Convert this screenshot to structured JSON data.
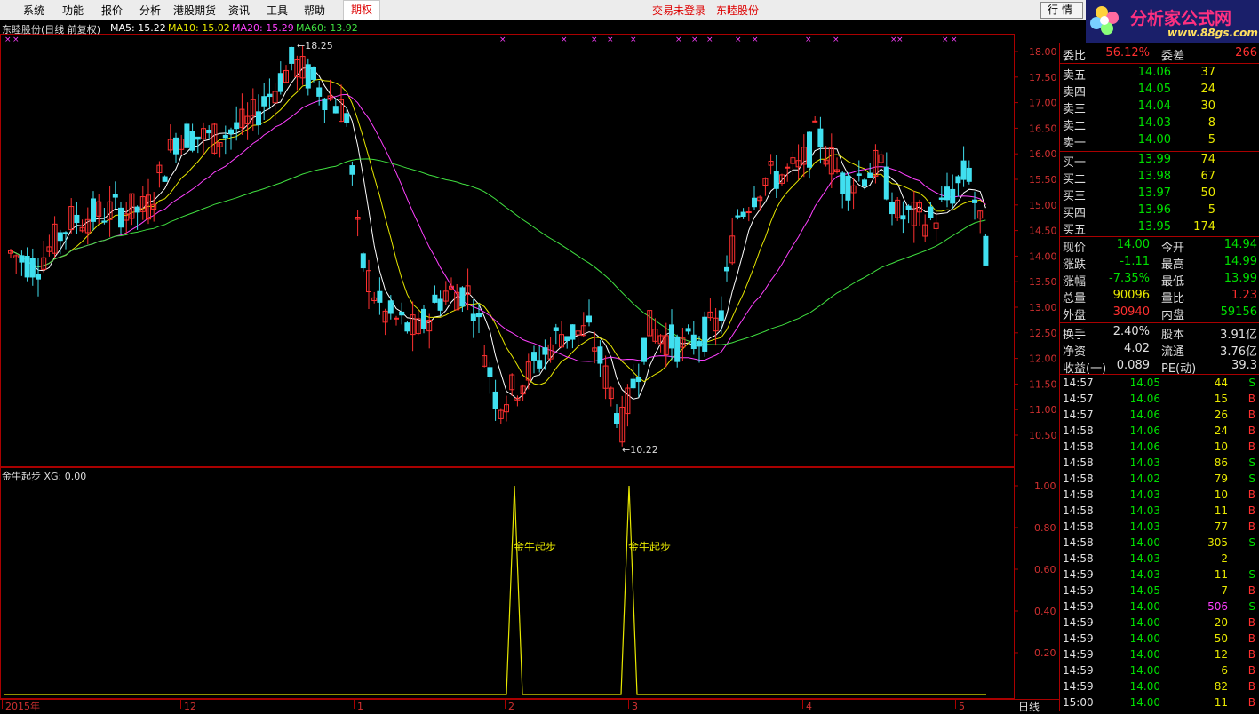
{
  "menu": {
    "items": [
      "系统",
      "功能",
      "报价",
      "分析",
      "港股期货",
      "资讯",
      "工具",
      "帮助"
    ],
    "option_tab": "期权",
    "status_login": "交易未登录",
    "status_stock": "东睦股份",
    "market_button": "行情"
  },
  "logo": {
    "brand": "分析家公式网",
    "url_text": "www.88gs.com"
  },
  "kline": {
    "title": "东睦股份(日线 前复权)",
    "ma5_label": "MA5: 15.22",
    "ma10_label": "MA10: 15.02",
    "ma20_label": "MA20: 15.29",
    "ma60_label": "MA60: 13.92",
    "high_mark": "18.25",
    "low_mark": "10.22",
    "y_ticks": [
      "18.00",
      "17.50",
      "17.00",
      "16.50",
      "16.00",
      "15.50",
      "15.00",
      "14.50",
      "14.00",
      "13.50",
      "13.00",
      "12.50",
      "12.00",
      "11.50",
      "11.00",
      "10.50"
    ],
    "x_ticks": [
      "2015年",
      "12",
      "1",
      "2",
      "3",
      "4",
      "5"
    ],
    "period_tab": "日线",
    "colors": {
      "up": "#ff3030",
      "down": "#40e0f0",
      "ma5": "#ffffff",
      "ma10": "#e8e800",
      "ma20": "#ff40ff",
      "ma60": "#40e040"
    }
  },
  "indicator": {
    "title": "金牛起步  XG: 0.00",
    "signal_label": "金牛起步",
    "y_ticks": [
      "1.00",
      "0.80",
      "0.60",
      "0.40",
      "0.20"
    ]
  },
  "quote": {
    "weibi": {
      "label": "委比",
      "value": "56.12%",
      "label2": "委差",
      "value2": "266"
    },
    "asks": [
      {
        "label": "卖五",
        "price": "14.06",
        "vol": "37"
      },
      {
        "label": "卖四",
        "price": "14.05",
        "vol": "24"
      },
      {
        "label": "卖三",
        "price": "14.04",
        "vol": "30"
      },
      {
        "label": "卖二",
        "price": "14.03",
        "vol": "8"
      },
      {
        "label": "卖一",
        "price": "14.00",
        "vol": "5"
      }
    ],
    "bids": [
      {
        "label": "买一",
        "price": "13.99",
        "vol": "74"
      },
      {
        "label": "买二",
        "price": "13.98",
        "vol": "67"
      },
      {
        "label": "买三",
        "price": "13.97",
        "vol": "50"
      },
      {
        "label": "买四",
        "price": "13.96",
        "vol": "5"
      },
      {
        "label": "买五",
        "price": "13.95",
        "vol": "174"
      }
    ],
    "stats": [
      {
        "l1": "现价",
        "v1": "14.00",
        "c1": "green",
        "l2": "今开",
        "v2": "14.94",
        "c2": "green"
      },
      {
        "l1": "涨跌",
        "v1": "-1.11",
        "c1": "green",
        "l2": "最高",
        "v2": "14.99",
        "c2": "green"
      },
      {
        "l1": "涨幅",
        "v1": "-7.35%",
        "c1": "green",
        "l2": "最低",
        "v2": "13.99",
        "c2": "green"
      },
      {
        "l1": "总量",
        "v1": "90096",
        "c1": "yellow",
        "l2": "量比",
        "v2": "1.23",
        "c2": "red"
      },
      {
        "l1": "外盘",
        "v1": "30940",
        "c1": "red",
        "l2": "内盘",
        "v2": "59156",
        "c2": "green"
      }
    ],
    "fundamentals": [
      {
        "l1": "换手",
        "v1": "2.40%",
        "l2": "股本",
        "v2": "3.91亿"
      },
      {
        "l1": "净资",
        "v1": "4.02",
        "l2": "流通",
        "v2": "3.76亿"
      },
      {
        "l1": "收益(一)",
        "v1": "0.089",
        "l2": "PE(动)",
        "v2": "39.3"
      }
    ],
    "ticks": [
      {
        "t": "14:57",
        "p": "14.05",
        "v": "44",
        "bs": "S"
      },
      {
        "t": "14:57",
        "p": "14.06",
        "v": "15",
        "bs": "B"
      },
      {
        "t": "14:57",
        "p": "14.06",
        "v": "26",
        "bs": "B"
      },
      {
        "t": "14:58",
        "p": "14.06",
        "v": "24",
        "bs": "B"
      },
      {
        "t": "14:58",
        "p": "14.06",
        "v": "10",
        "bs": "B"
      },
      {
        "t": "14:58",
        "p": "14.03",
        "v": "86",
        "bs": "S"
      },
      {
        "t": "14:58",
        "p": "14.02",
        "v": "79",
        "bs": "S"
      },
      {
        "t": "14:58",
        "p": "14.03",
        "v": "10",
        "bs": "B"
      },
      {
        "t": "14:58",
        "p": "14.03",
        "v": "11",
        "bs": "B"
      },
      {
        "t": "14:58",
        "p": "14.03",
        "v": "77",
        "bs": "B"
      },
      {
        "t": "14:58",
        "p": "14.00",
        "v": "305",
        "bs": "S"
      },
      {
        "t": "14:58",
        "p": "14.03",
        "v": "2",
        "bs": ""
      },
      {
        "t": "14:59",
        "p": "14.03",
        "v": "11",
        "bs": "S"
      },
      {
        "t": "14:59",
        "p": "14.05",
        "v": "7",
        "bs": "B"
      },
      {
        "t": "14:59",
        "p": "14.00",
        "v": "506",
        "bs": "S"
      },
      {
        "t": "14:59",
        "p": "14.00",
        "v": "20",
        "bs": "B"
      },
      {
        "t": "14:59",
        "p": "14.00",
        "v": "50",
        "bs": "B"
      },
      {
        "t": "14:59",
        "p": "14.00",
        "v": "12",
        "bs": "B"
      },
      {
        "t": "14:59",
        "p": "14.00",
        "v": "6",
        "bs": "B"
      },
      {
        "t": "14:59",
        "p": "14.00",
        "v": "82",
        "bs": "B"
      },
      {
        "t": "15:00",
        "p": "14.00",
        "v": "11",
        "bs": "B"
      }
    ]
  }
}
